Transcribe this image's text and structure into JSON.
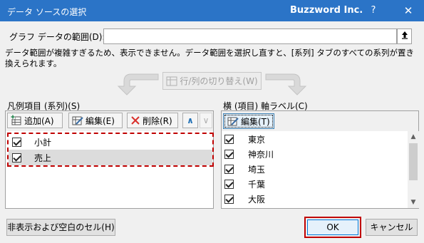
{
  "window": {
    "title": "データ ソースの選択",
    "brand": "Buzzword Inc.",
    "help_symbol": "?",
    "close_symbol": "✕"
  },
  "range": {
    "label": "グラフ データの範囲(D):",
    "value": "",
    "collapse_icon": "collapse-dialog-icon"
  },
  "message": "データ範囲が複雑すぎるため、表示できません。データ範囲を選択し直すと、[系列] タブのすべての系列が置き換えられます。",
  "switch_button": {
    "label": "行/列の切り替え(W)",
    "enabled": false
  },
  "legend": {
    "label": "凡例項目 (系列)(S)",
    "toolbar": {
      "add_label": "追加(A)",
      "edit_label": "編集(E)",
      "delete_label": "削除(R)",
      "up_symbol": "∧",
      "down_symbol": "∨"
    },
    "series": [
      {
        "name": "小計",
        "checked": true,
        "selected": false
      },
      {
        "name": "売上",
        "checked": true,
        "selected": true
      }
    ]
  },
  "axis": {
    "label": "横 (項目) 軸ラベル(C)",
    "edit_label": "編集(T)",
    "categories": [
      {
        "name": "東京",
        "checked": true
      },
      {
        "name": "神奈川",
        "checked": true
      },
      {
        "name": "埼玉",
        "checked": true
      },
      {
        "name": "千葉",
        "checked": true
      },
      {
        "name": "大阪",
        "checked": true
      }
    ]
  },
  "footer": {
    "hidden_cells_label": "非表示および空白のセル(H)",
    "ok_label": "OK",
    "cancel_label": "キャンセル"
  },
  "colors": {
    "titlebar": "#2b74c7",
    "highlight": "#c00000"
  }
}
